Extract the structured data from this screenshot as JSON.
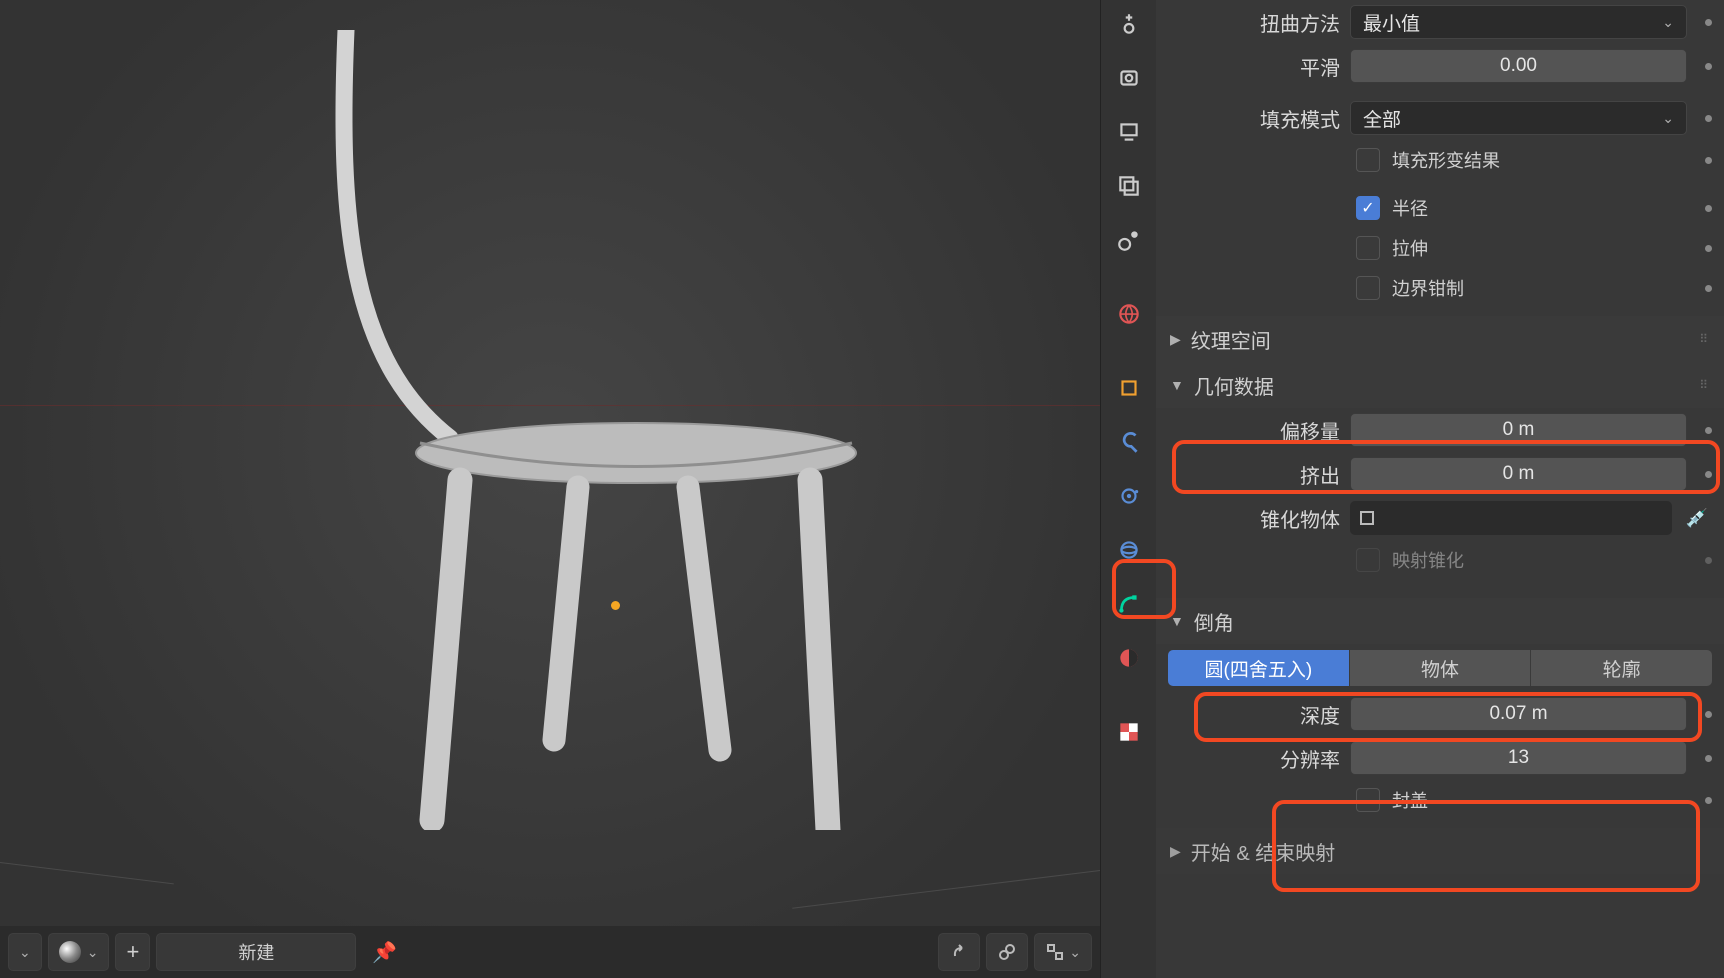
{
  "twist": {
    "label": "扭曲方法",
    "value": "最小值"
  },
  "smooth": {
    "label": "平滑",
    "value": "0.00"
  },
  "fillmode": {
    "label": "填充模式",
    "value": "全部"
  },
  "fill_deform": {
    "label": "填充形变结果",
    "checked": false
  },
  "radius": {
    "label": "半径",
    "checked": true
  },
  "stretch": {
    "label": "拉伸",
    "checked": false
  },
  "bounds_clamp": {
    "label": "边界钳制",
    "checked": false
  },
  "panels": {
    "tex_space": "纹理空间",
    "geometry": "几何数据",
    "bevel": "倒角",
    "start_end": "开始 & 结束映射"
  },
  "geom": {
    "offset": {
      "label": "偏移量",
      "value": "0 m"
    },
    "extrude": {
      "label": "挤出",
      "value": "0 m"
    },
    "taper": {
      "label": "锥化物体"
    },
    "map_taper": {
      "label": "映射锥化",
      "checked": false
    }
  },
  "bevel": {
    "tabs": {
      "round": "圆(四舍五入)",
      "object": "物体",
      "profile": "轮廓"
    },
    "depth": {
      "label": "深度",
      "value": "0.07 m"
    },
    "resolution": {
      "label": "分辨率",
      "value": "13"
    },
    "fill_caps": {
      "label": "封盖",
      "checked": false
    }
  },
  "bottom": {
    "new": "新建"
  }
}
